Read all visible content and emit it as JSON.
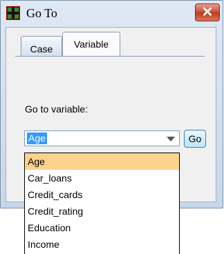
{
  "window": {
    "title": "Go To",
    "close_label": "✕"
  },
  "tabs": [
    {
      "label": "Case",
      "active": false
    },
    {
      "label": "Variable",
      "active": true
    }
  ],
  "goto_label": "Go to variable:",
  "combo": {
    "value": "Age"
  },
  "go_button": "Go",
  "options": [
    "Age",
    "Car_loans",
    "Credit_cards",
    "Credit_rating",
    "Education",
    "Income"
  ],
  "colors": {
    "selection_highlight": "#3399ff",
    "hover_option": "#fbd38c",
    "close_red": "#c84b32"
  }
}
